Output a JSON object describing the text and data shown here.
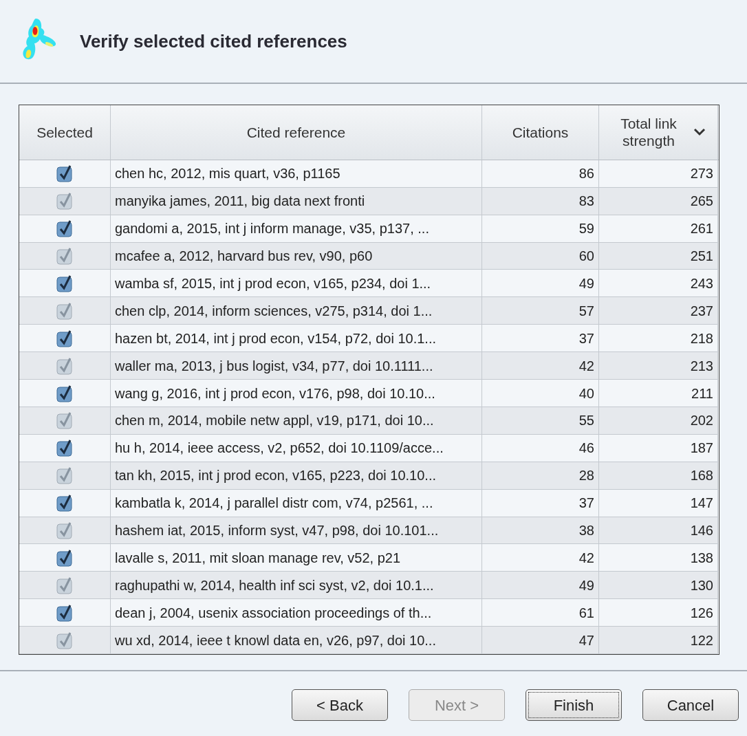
{
  "window": {
    "title": "Verify selected cited references"
  },
  "table": {
    "columns": [
      {
        "label": "Selected"
      },
      {
        "label": "Cited reference"
      },
      {
        "label": "Citations"
      },
      {
        "label": "Total link strength",
        "sorted": true
      }
    ],
    "rows": [
      {
        "checked": true,
        "reference": "chen hc, 2012, mis quart, v36, p1165",
        "citations": "86",
        "strength": "273"
      },
      {
        "checked": true,
        "reference": "manyika james, 2011, big data next fronti",
        "citations": "83",
        "strength": "265"
      },
      {
        "checked": true,
        "reference": "gandomi a, 2015, int j inform manage, v35, p137, ...",
        "citations": "59",
        "strength": "261"
      },
      {
        "checked": true,
        "reference": "mcafee a, 2012, harvard bus rev, v90, p60",
        "citations": "60",
        "strength": "251"
      },
      {
        "checked": true,
        "reference": "wamba sf, 2015, int j prod econ, v165, p234, doi 1...",
        "citations": "49",
        "strength": "243"
      },
      {
        "checked": true,
        "reference": "chen clp, 2014, inform sciences, v275, p314, doi 1...",
        "citations": "57",
        "strength": "237"
      },
      {
        "checked": true,
        "reference": "hazen bt, 2014, int j prod econ, v154, p72, doi 10.1...",
        "citations": "37",
        "strength": "218"
      },
      {
        "checked": true,
        "reference": "waller ma, 2013, j bus logist, v34, p77, doi 10.1111...",
        "citations": "42",
        "strength": "213"
      },
      {
        "checked": true,
        "reference": "wang g, 2016, int j prod econ, v176, p98, doi 10.10...",
        "citations": "40",
        "strength": "211"
      },
      {
        "checked": true,
        "reference": "chen m, 2014, mobile netw appl, v19, p171, doi 10...",
        "citations": "55",
        "strength": "202"
      },
      {
        "checked": true,
        "reference": "hu h, 2014, ieee access, v2, p652, doi 10.1109/acce...",
        "citations": "46",
        "strength": "187"
      },
      {
        "checked": true,
        "reference": "tan kh, 2015, int j prod econ, v165, p223, doi 10.10...",
        "citations": "28",
        "strength": "168"
      },
      {
        "checked": true,
        "reference": "kambatla k, 2014, j parallel distr com, v74, p2561, ...",
        "citations": "37",
        "strength": "147"
      },
      {
        "checked": true,
        "reference": "hashem iat, 2015, inform syst, v47, p98, doi 10.101...",
        "citations": "38",
        "strength": "146"
      },
      {
        "checked": true,
        "reference": "lavalle s, 2011, mit sloan manage rev, v52, p21",
        "citations": "42",
        "strength": "138"
      },
      {
        "checked": true,
        "reference": "raghupathi w, 2014, health inf sci syst, v2, doi 10.1...",
        "citations": "49",
        "strength": "130"
      },
      {
        "checked": true,
        "reference": "dean j, 2004, usenix association proceedings of th...",
        "citations": "61",
        "strength": "126"
      },
      {
        "checked": true,
        "reference": "wu xd, 2014, ieee t knowl data en, v26, p97, doi 10...",
        "citations": "47",
        "strength": "122"
      }
    ]
  },
  "buttons": [
    {
      "label": "< Back",
      "disabled": false,
      "focused": false
    },
    {
      "label": "Next >",
      "disabled": true,
      "focused": false
    },
    {
      "label": "Finish",
      "disabled": false,
      "focused": true
    },
    {
      "label": "Cancel",
      "disabled": false,
      "focused": false
    }
  ]
}
